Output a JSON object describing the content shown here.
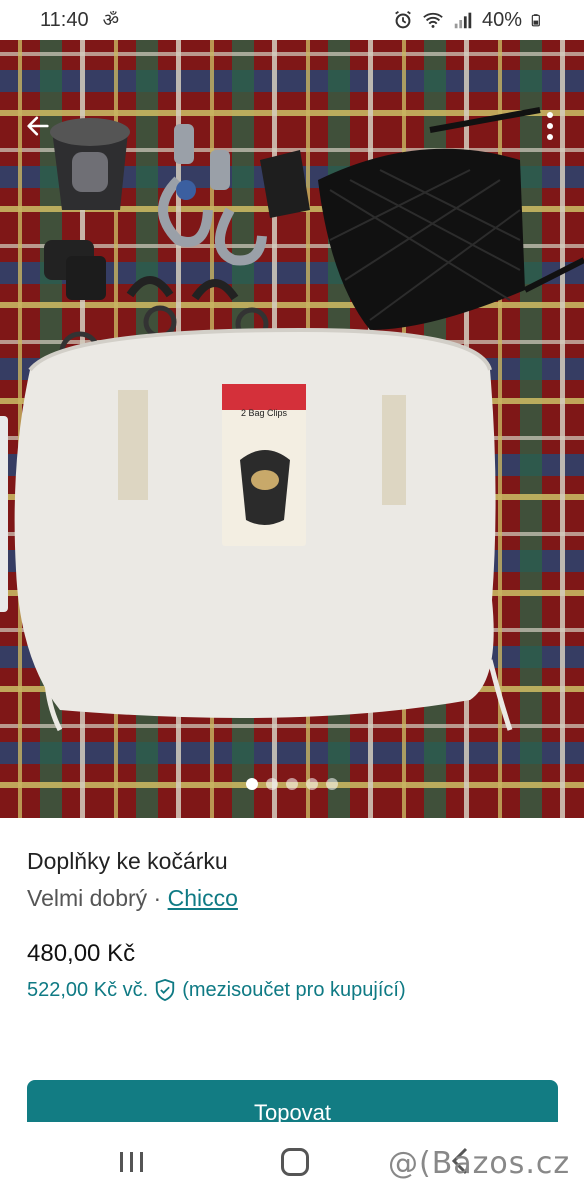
{
  "status_bar": {
    "time": "11:40",
    "battery": "40%",
    "icons": [
      "om-icon",
      "alarm-icon",
      "wifi-icon",
      "signal-icon",
      "battery-icon"
    ]
  },
  "photo": {
    "label_on_package": "2 Bag Clips",
    "carousel_count": 5,
    "carousel_active": 0
  },
  "listing": {
    "title": "Doplňky ke kočárku",
    "condition": "Velmi dobrý",
    "separator": " · ",
    "brand": "Chicco",
    "price": "480,00 Kč",
    "price_total": "522,00 Kč vč.",
    "price_total_note": "(mezisoučet pro kupující)"
  },
  "buy_button": {
    "label": "Topovat"
  },
  "watermark": "@(Bazos.cz",
  "colors": {
    "accent": "#127c83",
    "link": "#0f7a84"
  }
}
